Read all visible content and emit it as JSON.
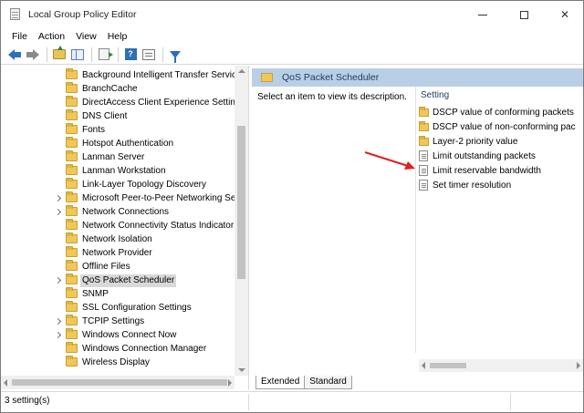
{
  "window": {
    "title": "Local Group Policy Editor"
  },
  "menu": [
    "File",
    "Action",
    "View",
    "Help"
  ],
  "tree": {
    "items": [
      {
        "label": "Background Intelligent Transfer Servic",
        "expandable": false
      },
      {
        "label": "BranchCache",
        "expandable": false
      },
      {
        "label": "DirectAccess Client Experience Setting",
        "expandable": false
      },
      {
        "label": "DNS Client",
        "expandable": false
      },
      {
        "label": "Fonts",
        "expandable": false
      },
      {
        "label": "Hotspot Authentication",
        "expandable": false
      },
      {
        "label": "Lanman Server",
        "expandable": false
      },
      {
        "label": "Lanman Workstation",
        "expandable": false
      },
      {
        "label": "Link-Layer Topology Discovery",
        "expandable": false
      },
      {
        "label": "Microsoft Peer-to-Peer Networking Se",
        "expandable": true
      },
      {
        "label": "Network Connections",
        "expandable": true
      },
      {
        "label": "Network Connectivity Status Indicator",
        "expandable": false
      },
      {
        "label": "Network Isolation",
        "expandable": false
      },
      {
        "label": "Network Provider",
        "expandable": false
      },
      {
        "label": "Offline Files",
        "expandable": false
      },
      {
        "label": "QoS Packet Scheduler",
        "expandable": true,
        "selected": true
      },
      {
        "label": "SNMP",
        "expandable": false
      },
      {
        "label": "SSL Configuration Settings",
        "expandable": false
      },
      {
        "label": "TCPIP Settings",
        "expandable": true
      },
      {
        "label": "Windows Connect Now",
        "expandable": true
      },
      {
        "label": "Windows Connection Manager",
        "expandable": false
      },
      {
        "label": "Wireless Display",
        "expandable": false
      }
    ]
  },
  "details": {
    "header_title": "QoS Packet Scheduler",
    "description": "Select an item to view its description.",
    "column_header": "Setting",
    "settings": [
      {
        "label": "DSCP value of conforming packets",
        "kind": "folder"
      },
      {
        "label": "DSCP value of non-conforming pac",
        "kind": "folder"
      },
      {
        "label": "Layer-2 priority value",
        "kind": "folder"
      },
      {
        "label": "Limit outstanding packets",
        "kind": "policy"
      },
      {
        "label": "Limit reservable bandwidth",
        "kind": "policy"
      },
      {
        "label": "Set timer resolution",
        "kind": "policy"
      }
    ],
    "tabs": [
      "Extended",
      "Standard"
    ]
  },
  "status": {
    "text": "3 setting(s)"
  },
  "colors": {
    "header_bg": "#b9cfe6",
    "annotation_arrow": "#e02020",
    "selected_bg": "#d9d9d9"
  }
}
